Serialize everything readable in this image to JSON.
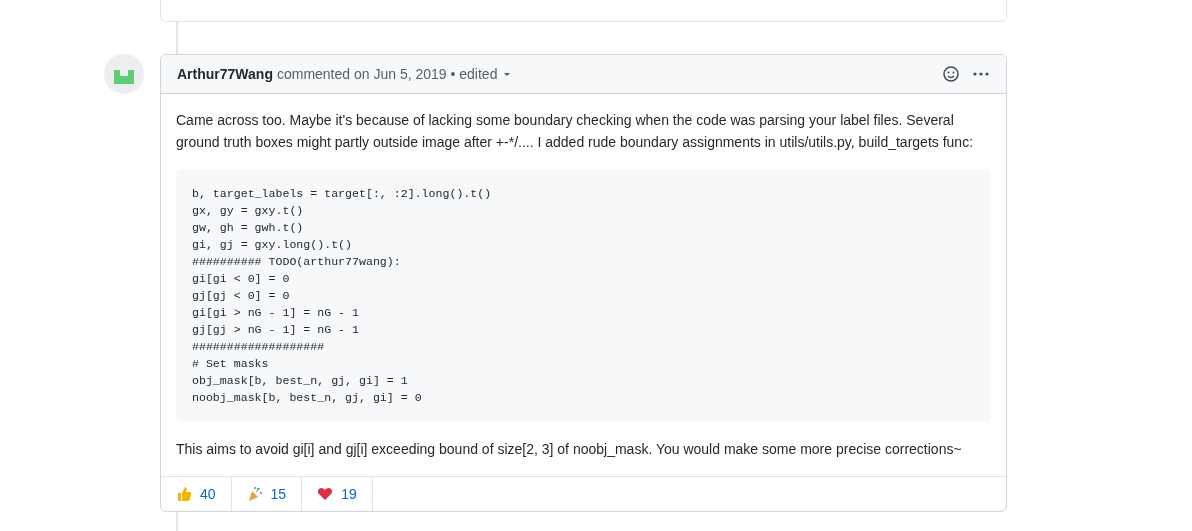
{
  "comment": {
    "author": "Arthur77Wang",
    "meta": "commented on Jun 5, 2019 • edited",
    "paragraphs": [
      "Came across too. Maybe it's because of lacking some boundary checking when the code was parsing your label files. Several ground truth boxes might partly outside image after +-*/.... I added rude boundary assignments in utils/utils.py, build_targets func:"
    ],
    "code": [
      "b, target_labels = target[:, :2].long().t()",
      "gx, gy = gxy.t()",
      "gw, gh = gwh.t()",
      "gi, gj = gxy.long().t()",
      "########## TODO(arthur77wang):",
      "gi[gi < 0] = 0",
      "gj[gj < 0] = 0",
      "gi[gi > nG - 1] = nG - 1",
      "gj[gj > nG - 1] = nG - 1",
      "###################",
      "# Set masks",
      "obj_mask[b, best_n, gj, gi] = 1",
      "noobj_mask[b, best_n, gj, gi] = 0"
    ],
    "closing": "This aims to avoid gi[i] and gj[i] exceeding bound of size[2, 3] of noobj_mask. You would make some more precise corrections~",
    "reactions": [
      {
        "kind": "thumbs-up",
        "count": "40"
      },
      {
        "kind": "party",
        "count": "15"
      },
      {
        "kind": "heart",
        "count": "19"
      }
    ]
  }
}
